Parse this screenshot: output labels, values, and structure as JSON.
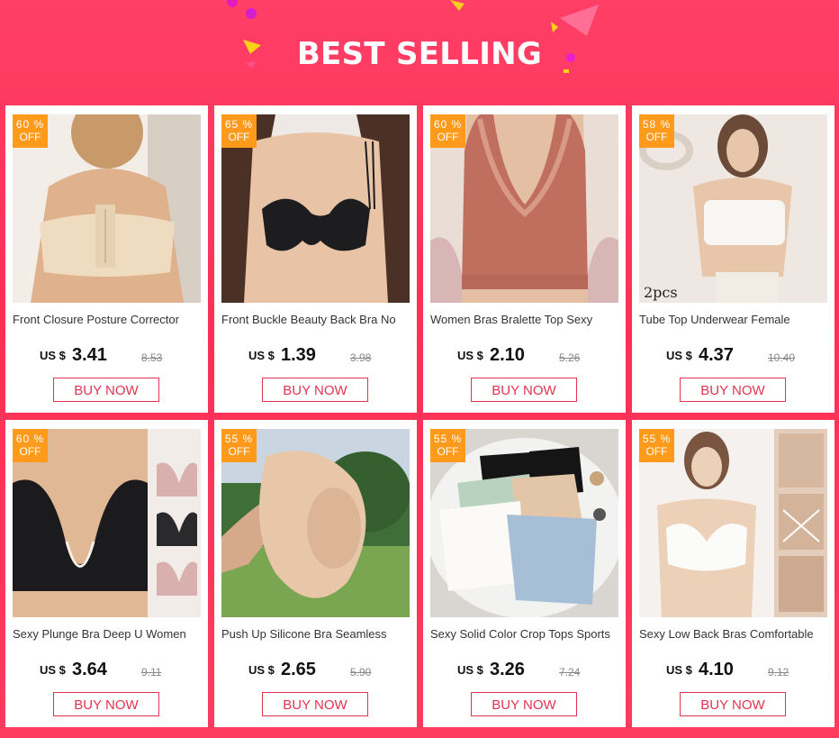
{
  "banner": {
    "title": "BEST SELLING"
  },
  "products": [
    {
      "title": "Front Closure Posture Corrector",
      "badge_pct": "60 %",
      "badge_off": "OFF",
      "currency": "US $",
      "price": "3.41",
      "old_price": "8.53",
      "buy_label": "BUY NOW"
    },
    {
      "title": "Front Buckle Beauty Back Bra No",
      "badge_pct": "65 %",
      "badge_off": "OFF",
      "currency": "US $",
      "price": "1.39",
      "old_price": "3.98",
      "buy_label": "BUY NOW"
    },
    {
      "title": "Women Bras Bralette Top Sexy",
      "badge_pct": "60 %",
      "badge_off": "OFF",
      "currency": "US $",
      "price": "2.10",
      "old_price": "5.26",
      "buy_label": "BUY NOW"
    },
    {
      "title": "Tube Top Underwear Female",
      "badge_pct": "58 %",
      "badge_off": "OFF",
      "currency": "US $",
      "price": "4.37",
      "old_price": "10.40",
      "buy_label": "BUY NOW",
      "image_text": "2pcs"
    },
    {
      "title": "Sexy Plunge Bra Deep U Women",
      "badge_pct": "60 %",
      "badge_off": "OFF",
      "currency": "US $",
      "price": "3.64",
      "old_price": "9.11",
      "buy_label": "BUY NOW"
    },
    {
      "title": "Push Up Silicone Bra Seamless",
      "badge_pct": "55 %",
      "badge_off": "OFF",
      "currency": "US $",
      "price": "2.65",
      "old_price": "5.90",
      "buy_label": "BUY NOW"
    },
    {
      "title": "Sexy Solid Color Crop Tops Sports",
      "badge_pct": "55 %",
      "badge_off": "OFF",
      "currency": "US $",
      "price": "3.26",
      "old_price": "7.24",
      "buy_label": "BUY NOW"
    },
    {
      "title": "Sexy Low Back Bras Comfortable",
      "badge_pct": "55 %",
      "badge_off": "OFF",
      "currency": "US $",
      "price": "4.10",
      "old_price": "9.12",
      "buy_label": "BUY NOW"
    }
  ],
  "colors": {
    "accent": "#e0344f",
    "badge": "#ff9a1a",
    "background": "#ff3159"
  }
}
